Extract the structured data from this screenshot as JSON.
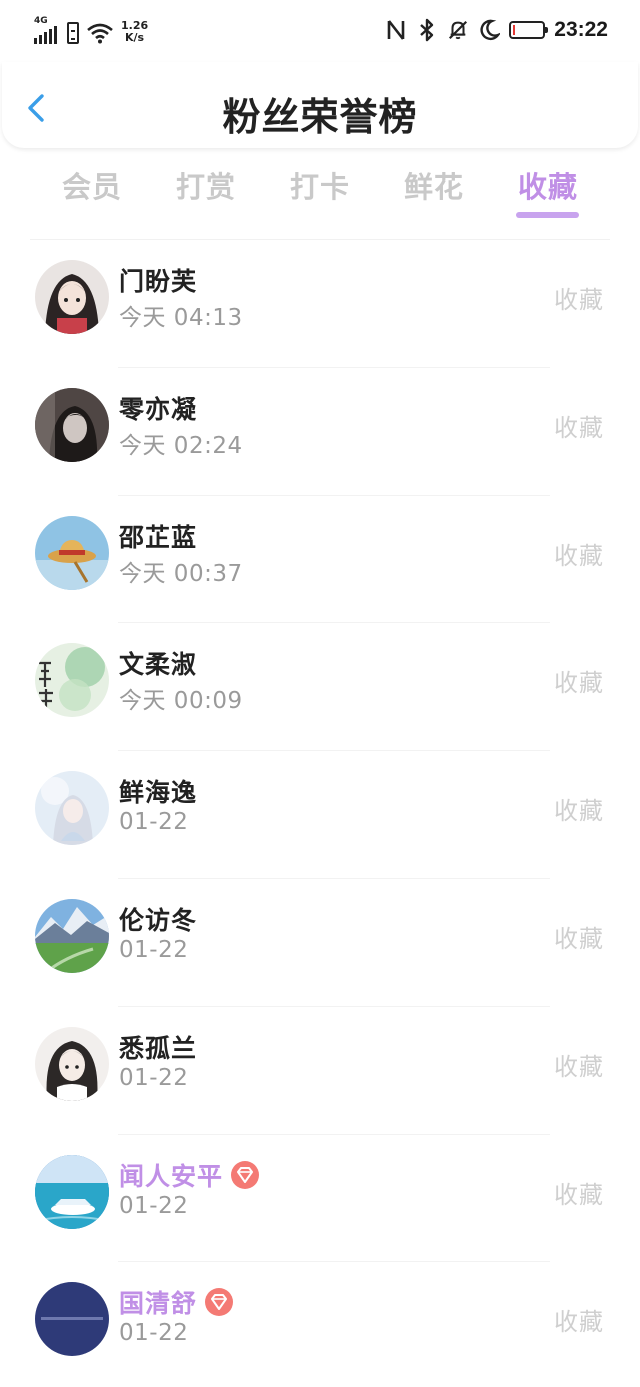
{
  "status_bar": {
    "network_type": "4G",
    "net_speed_value": "1.26",
    "net_speed_unit": "K/s",
    "time": "23:22"
  },
  "header": {
    "title": "粉丝荣誉榜"
  },
  "tabs": [
    {
      "label": "会员"
    },
    {
      "label": "打赏"
    },
    {
      "label": "打卡"
    },
    {
      "label": "鲜花"
    },
    {
      "label": "收藏"
    }
  ],
  "active_tab": "收藏",
  "colors": {
    "accent": "#c08fe6",
    "back_arrow": "#3a9ee8",
    "vip_badge": "#f47a74"
  },
  "fans": [
    {
      "name": "门盼芙",
      "time": "今天  04:13",
      "action": "收藏",
      "vip": false
    },
    {
      "name": "零亦凝",
      "time": "今天  02:24",
      "action": "收藏",
      "vip": false
    },
    {
      "name": "邵芷蓝",
      "time": "今天  00:37",
      "action": "收藏",
      "vip": false
    },
    {
      "name": "文柔淑",
      "time": "今天  00:09",
      "action": "收藏",
      "vip": false
    },
    {
      "name": "鲜海逸",
      "time": "01-22",
      "action": "收藏",
      "vip": false
    },
    {
      "name": "伦访冬",
      "time": "01-22",
      "action": "收藏",
      "vip": false
    },
    {
      "name": "悉孤兰",
      "time": "01-22",
      "action": "收藏",
      "vip": false
    },
    {
      "name": "闻人安平",
      "time": "01-22",
      "action": "收藏",
      "vip": true
    },
    {
      "name": "国清舒",
      "time": "01-22",
      "action": "收藏",
      "vip": true
    }
  ]
}
